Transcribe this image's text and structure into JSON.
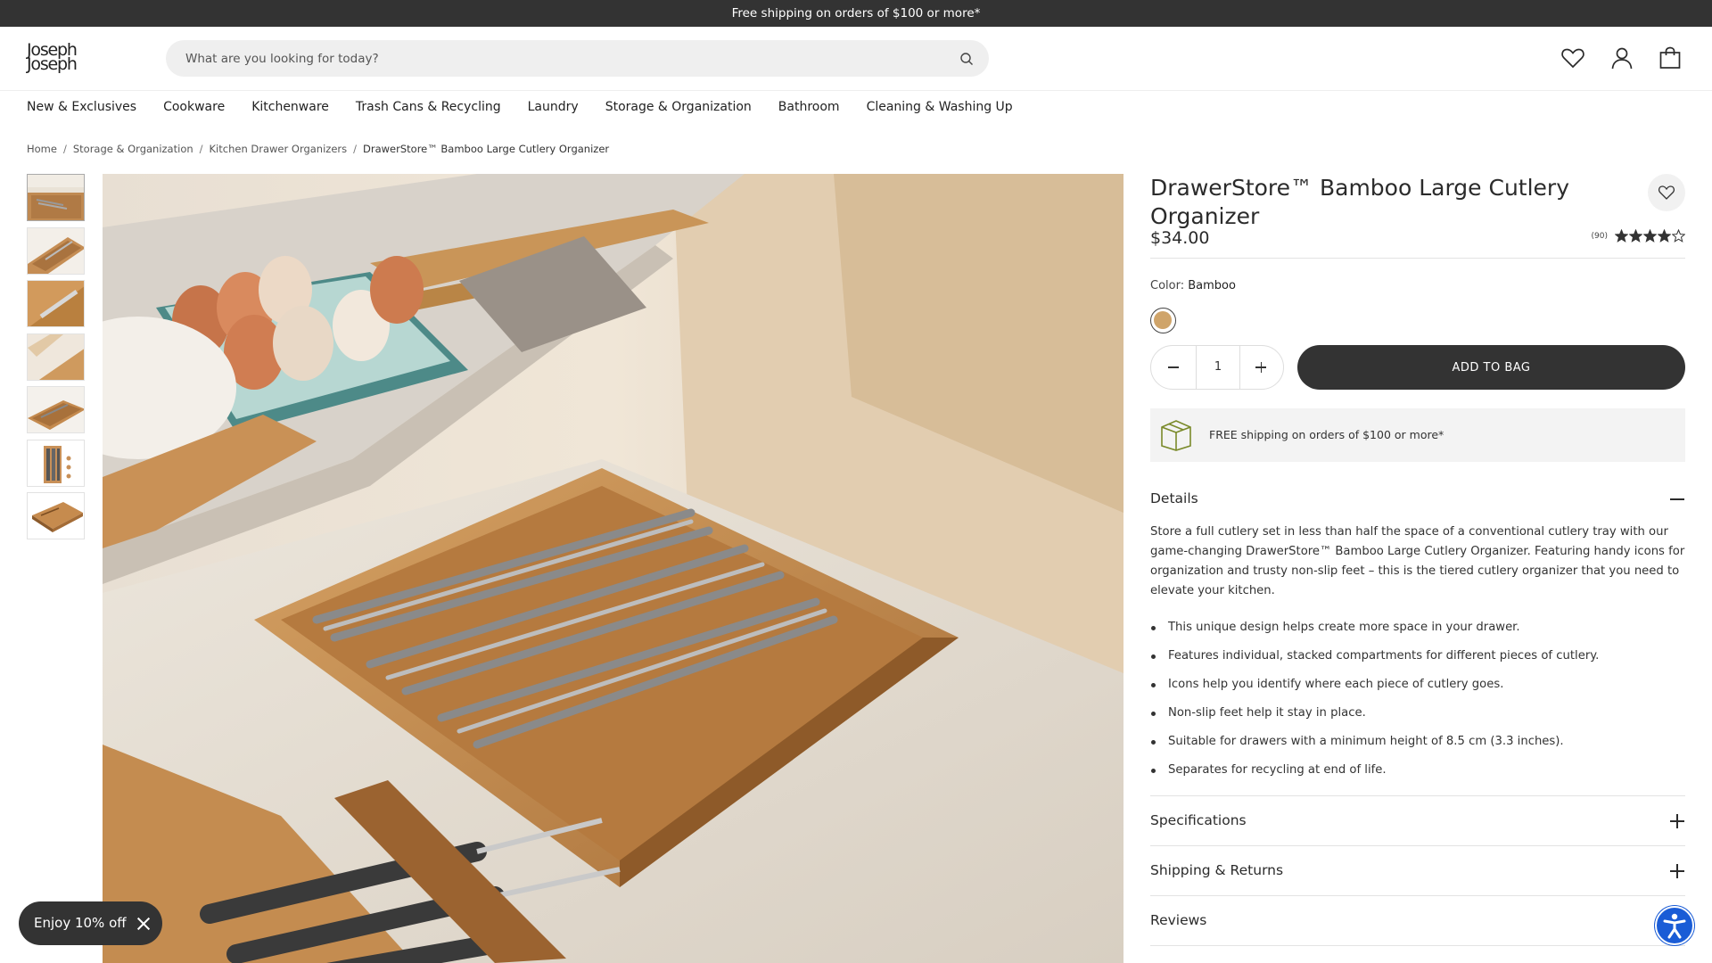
{
  "promo_bar": {
    "text": "Free shipping on orders of $100 or more*"
  },
  "header": {
    "logo_line1": "Joseph",
    "logo_line2": "Joseph",
    "search_placeholder": "What are you looking for today?",
    "icons": [
      "search-icon",
      "heart-icon",
      "user-icon",
      "bag-icon"
    ]
  },
  "nav": {
    "items": [
      {
        "label": "New & Exclusives"
      },
      {
        "label": "Cookware"
      },
      {
        "label": "Kitchenware"
      },
      {
        "label": "Trash Cans & Recycling"
      },
      {
        "label": "Laundry"
      },
      {
        "label": "Storage & Organization"
      },
      {
        "label": "Bathroom"
      },
      {
        "label": "Cleaning & Washing Up"
      }
    ]
  },
  "breadcrumb": {
    "items": [
      {
        "label": "Home"
      },
      {
        "label": "Storage & Organization"
      },
      {
        "label": "Kitchen Drawer Organizers"
      },
      {
        "label": "DrawerStore™ Bamboo Large Cutlery Organizer"
      }
    ],
    "separator": "/"
  },
  "product": {
    "title": "DrawerStore™ Bamboo Large Cutlery Organizer",
    "price": "$34.00",
    "rating_count": "(90)",
    "rating_value": 4,
    "rating_max": 5,
    "color_label": "Color:",
    "color_value": "Bamboo",
    "swatch_color": "#cfa46a",
    "quantity": "1",
    "add_to_bag": "ADD TO BAG",
    "shipping_note": "FREE shipping on orders of $100 or more*"
  },
  "details": {
    "heading": "Details",
    "description": "Store a full cutlery set in less than half the space of a conventional cutlery tray with our game-changing DrawerStore™ Bamboo Large Cutlery Organizer. Featuring handy icons for organization and trusty non-slip feet – this is the tiered cutlery organizer that you need to elevate your kitchen.",
    "bullets": [
      "This unique design helps create more space in your drawer.",
      "Features individual, stacked compartments for different pieces of cutlery.",
      "Icons help you identify where each piece of cutlery goes.",
      "Non-slip feet help it stay in place.",
      "Suitable for drawers with a minimum height of 8.5 cm (3.3 inches).",
      "Separates for recycling at end of life."
    ]
  },
  "accordions": {
    "specifications": "Specifications",
    "shipping_returns": "Shipping & Returns",
    "reviews": "Reviews"
  },
  "floating": {
    "discount_pill": "Enjoy 10% off"
  },
  "colors": {
    "dark": "#333333",
    "accessibility_blue": "#1a5cd6"
  }
}
